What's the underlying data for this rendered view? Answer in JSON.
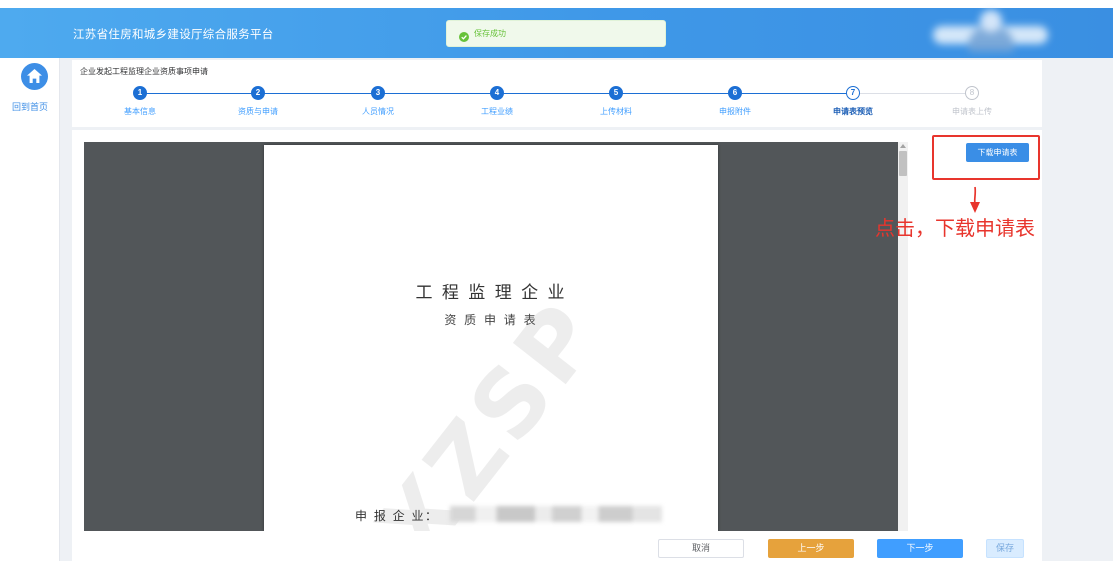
{
  "header": {
    "title": "江苏省住房和城乡建设厅综合服务平台",
    "toast": {
      "icon": "check-circle-icon",
      "text": "保存成功"
    }
  },
  "sidebar": {
    "home": {
      "icon": "home-icon",
      "label": "回到首页"
    }
  },
  "breadcrumb": "企业发起工程监理企业资质事项申请",
  "current_step": 7,
  "steps": [
    {
      "number": "1",
      "label": "基本信息"
    },
    {
      "number": "2",
      "label": "资质与申请"
    },
    {
      "number": "3",
      "label": "人员情况"
    },
    {
      "number": "4",
      "label": "工程业绩"
    },
    {
      "number": "5",
      "label": "上传材料"
    },
    {
      "number": "6",
      "label": "申报附件"
    },
    {
      "number": "7",
      "label": "申请表预览"
    },
    {
      "number": "8",
      "label": "申请表上传"
    }
  ],
  "preview": {
    "title": "工 程 监 理 企 业",
    "subtitle": "资 质 申 请 表",
    "watermark": "XZSP",
    "applicant_label": "申 报 企 业："
  },
  "actions": {
    "download_label": "下载申请表"
  },
  "annotation": {
    "text": "点击，下载申请表",
    "arrow_icon": "arrow-down-icon"
  },
  "footer": {
    "cancel_label": "取消",
    "prev_label": "上一步",
    "next_label": "下一步",
    "save_label": "保存"
  },
  "colors": {
    "header": "#3f98e8",
    "accent": "#409eff",
    "step_done": "#1c6fd4",
    "success": "#67c23a",
    "warning": "#e6a23c",
    "annotation": "#e8352d",
    "viewer": "#525659",
    "muted": "#c0c4cc"
  }
}
